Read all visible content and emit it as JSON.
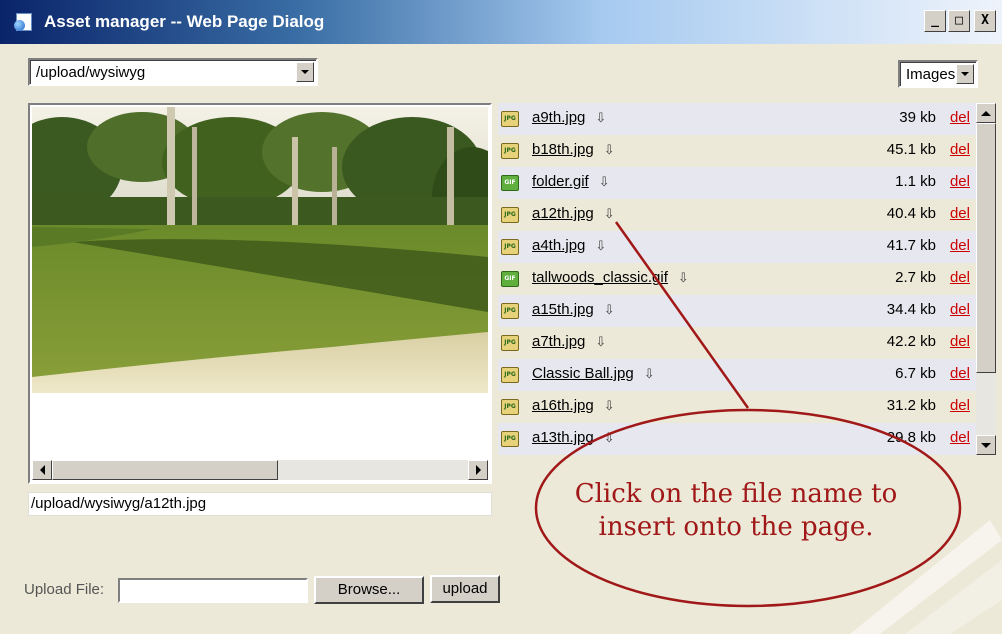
{
  "window": {
    "title": "Asset manager -- Web Page Dialog",
    "controls": {
      "minimize": "_",
      "maximize": "□",
      "close": "X"
    }
  },
  "folder_select": {
    "value": "/upload/wysiwyg"
  },
  "type_select": {
    "value": "Images"
  },
  "preview": {
    "path_value": "/upload/wysiwyg/a12th.jpg"
  },
  "files": [
    {
      "name": "a9th.jpg",
      "size": "39 kb",
      "delete": "del",
      "kind": "jpg"
    },
    {
      "name": "b18th.jpg",
      "size": "45.1 kb",
      "delete": "del",
      "kind": "jpg"
    },
    {
      "name": "folder.gif",
      "size": "1.1 kb",
      "delete": "del",
      "kind": "gif"
    },
    {
      "name": "a12th.jpg",
      "size": "40.4 kb",
      "delete": "del",
      "kind": "jpg"
    },
    {
      "name": "a4th.jpg",
      "size": "41.7 kb",
      "delete": "del",
      "kind": "jpg"
    },
    {
      "name": "tallwoods_classic.gif",
      "size": "2.7 kb",
      "delete": "del",
      "kind": "gif"
    },
    {
      "name": "a15th.jpg",
      "size": "34.4 kb",
      "delete": "del",
      "kind": "jpg"
    },
    {
      "name": "a7th.jpg",
      "size": "42.2 kb",
      "delete": "del",
      "kind": "jpg"
    },
    {
      "name": "Classic Ball.jpg",
      "size": "6.7 kb",
      "delete": "del",
      "kind": "jpg"
    },
    {
      "name": "a16th.jpg",
      "size": "31.2 kb",
      "delete": "del",
      "kind": "jpg"
    },
    {
      "name": "a13th.jpg",
      "size": "29.8 kb",
      "delete": "del",
      "kind": "jpg"
    }
  ],
  "icons": {
    "download": "⇩",
    "jpg_label": "JPG",
    "gif_label": "GIF"
  },
  "annotation": {
    "line1": "Click on the file name to",
    "line2": "insert onto the page.",
    "color": "#a01818"
  },
  "upload": {
    "label": "Upload File:",
    "value": "",
    "browse_label": "Browse...",
    "upload_label": "upload"
  }
}
